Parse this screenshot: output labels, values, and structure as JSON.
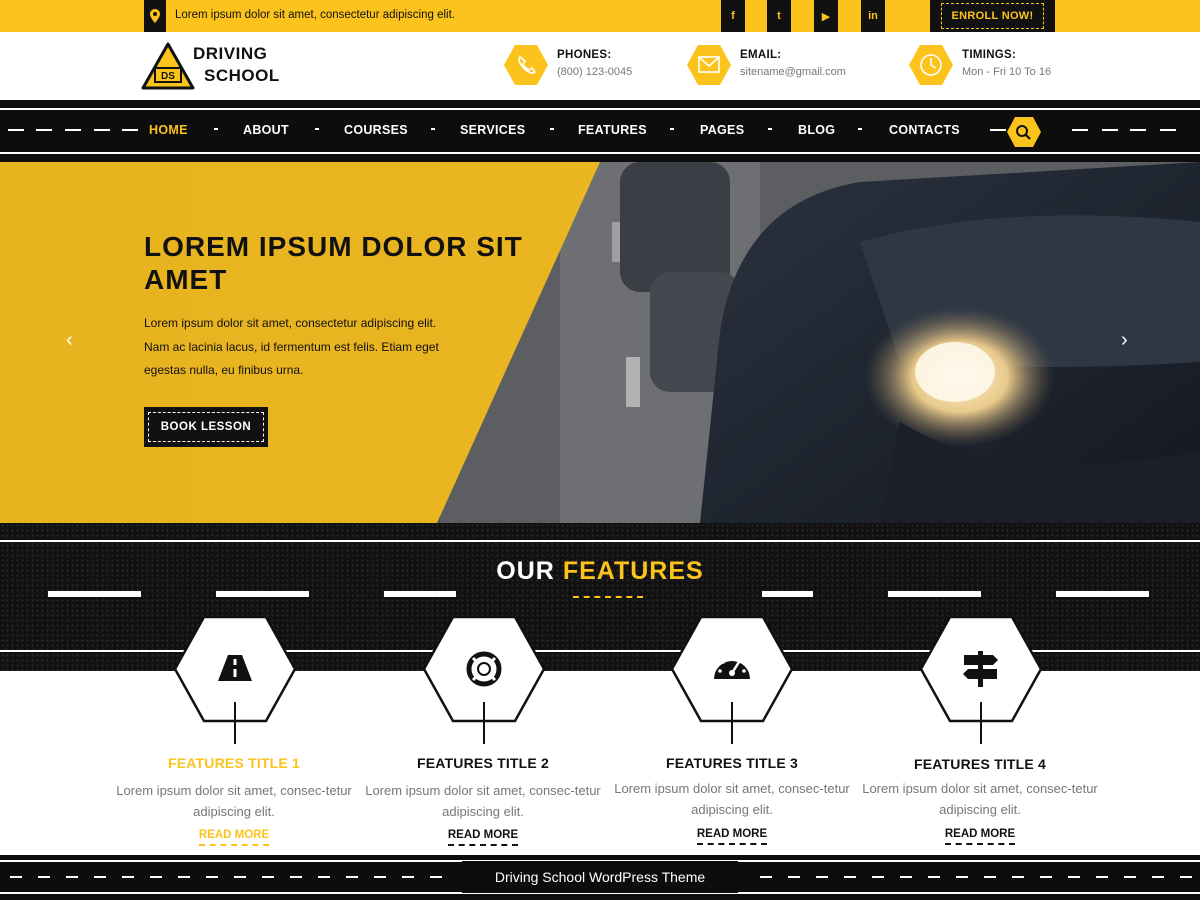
{
  "topbar": {
    "address_text": "Lorem ipsum dolor sit amet, consectetur adipiscing elit.",
    "social": [
      {
        "icon": "facebook-icon",
        "glyph": "f"
      },
      {
        "icon": "twitter-icon",
        "glyph": "t"
      },
      {
        "icon": "youtube-icon",
        "glyph": "▶"
      },
      {
        "icon": "linkedin-icon",
        "glyph": "in"
      }
    ],
    "enroll_label": "ENROLL NOW!"
  },
  "header": {
    "logo_badge": "DS",
    "logo_line1": "DRIVING",
    "logo_line2": "SCHOOL",
    "phones_label": "PHONES:",
    "phones_value": "(800) 123-0045",
    "email_label": "EMAIL:",
    "email_value": "sitename@gmail.com",
    "timings_label": "TIMINGS:",
    "timings_value": "Mon - Fri 10 To 16"
  },
  "nav": {
    "items": [
      "HOME",
      "ABOUT",
      "COURSES",
      "SERVICES",
      "FEATURES",
      "PAGES",
      "BLOG",
      "CONTACTS"
    ],
    "active": "HOME"
  },
  "hero": {
    "title": "LOREM IPSUM DOLOR SIT AMET",
    "description": "Lorem ipsum dolor sit amet, consectetur adipiscing elit. Nam ac lacinia lacus, id fermentum est felis. Etiam eget egestas nulla, eu finibus urna.",
    "button_label": "BOOK LESSON",
    "prev_arrow": "‹",
    "next_arrow": "›"
  },
  "features": {
    "title_part1": "OUR",
    "title_part2": "FEATURES",
    "items": [
      {
        "title": "FEATURES TITLE 1",
        "desc": "Lorem ipsum dolor sit amet, consec-tetur adipiscing elit.",
        "link": "READ MORE",
        "icon": "road-icon"
      },
      {
        "title": "FEATURES TITLE 2",
        "desc": "Lorem ipsum dolor sit amet, consec-tetur adipiscing elit.",
        "link": "READ MORE",
        "icon": "lifebuoy-icon"
      },
      {
        "title": "FEATURES TITLE 3",
        "desc": "Lorem ipsum dolor sit amet, consec-tetur adipiscing elit.",
        "link": "READ MORE",
        "icon": "speedometer-icon"
      },
      {
        "title": "FEATURES TITLE 4",
        "desc": "Lorem ipsum dolor sit amet, consec-tetur adipiscing elit.",
        "link": "READ MORE",
        "icon": "signpost-icon"
      }
    ]
  },
  "footer": {
    "text": "Driving School WordPress Theme"
  },
  "colors": {
    "accent": "#fbc31c",
    "dark": "#111111"
  }
}
